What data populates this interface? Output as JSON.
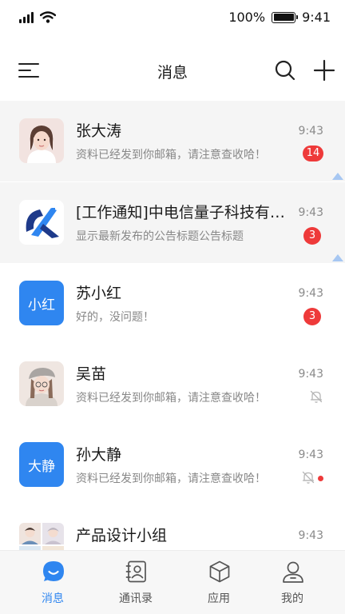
{
  "status_bar": {
    "battery_text": "100%",
    "time": "9:41",
    "battery_level": 1.0
  },
  "nav": {
    "title": "消息",
    "icons": [
      "menu-icon",
      "search-icon",
      "add-icon"
    ]
  },
  "chats": [
    {
      "name": "张大涛",
      "preview": "资料已经发到你邮箱，请注意查收哈！",
      "time": "9:43",
      "badge": "14",
      "badge_style": "pill",
      "pinned": true,
      "avatar": "portrait-girl"
    },
    {
      "name": "[工作通知]中电信量子科技有限公司",
      "preview": "显示最新发布的公告标题公告标题",
      "time": "9:43",
      "badge": "3",
      "badge_style": "circle",
      "pinned": true,
      "avatar": "company-logo"
    },
    {
      "name": "苏小红",
      "preview": "好的，没问题！",
      "time": "9:43",
      "badge": "3",
      "badge_style": "circle",
      "pinned": false,
      "avatar_text": "小红"
    },
    {
      "name": "吴苗",
      "preview": "资料已经发到你邮箱，请注意查收哈！",
      "time": "9:43",
      "muted": true,
      "pinned": false,
      "avatar": "portrait-braids"
    },
    {
      "name": "孙大静",
      "preview": "资料已经发到你邮箱，请注意查收哈！",
      "time": "9:43",
      "muted": true,
      "unread_dot": true,
      "pinned": false,
      "avatar_text": "大静"
    },
    {
      "name": "产品设计小组",
      "preview": "",
      "time": "9:43",
      "pinned": false,
      "avatar": "group-collage"
    }
  ],
  "tabs": [
    {
      "label": "消息",
      "icon": "chat-bubble-icon",
      "active": true
    },
    {
      "label": "通讯录",
      "icon": "contacts-icon",
      "active": false
    },
    {
      "label": "应用",
      "icon": "apps-cube-icon",
      "active": false
    },
    {
      "label": "我的",
      "icon": "profile-icon",
      "active": false
    }
  ],
  "colors": {
    "accent": "#2f86f0",
    "badge": "#ee3a3a",
    "pinned_bg": "#f5f5f5"
  }
}
